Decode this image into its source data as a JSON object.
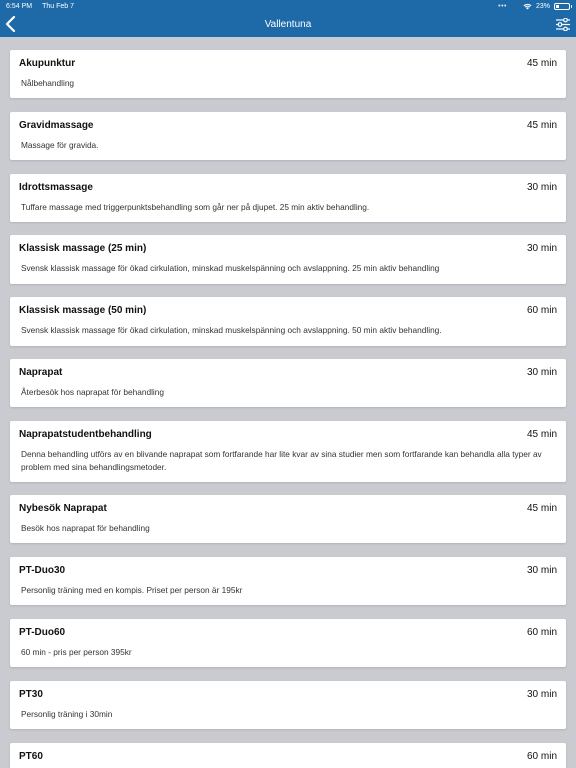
{
  "status": {
    "time": "6:54 PM",
    "date": "Thu Feb 7",
    "battery": "23%",
    "battery_level": 0.23,
    "dots": "•••"
  },
  "nav": {
    "title": "Vallentuna",
    "back_icon": "chevron-left-icon",
    "filter_icon": "sliders-icon"
  },
  "colors": {
    "accent": "#1e6aa8",
    "background": "#c9cbd0",
    "card": "#ffffff"
  },
  "services": [
    {
      "name": "Akupunktur",
      "duration": "45 min",
      "description": "Nålbehandling"
    },
    {
      "name": "Gravidmassage",
      "duration": "45 min",
      "description": "Massage för gravida."
    },
    {
      "name": "Idrottsmassage",
      "duration": "30 min",
      "description": "Tuffare massage med triggerpunktsbehandling som går ner på djupet. 25 min aktiv behandling."
    },
    {
      "name": "Klassisk massage (25 min)",
      "duration": "30 min",
      "description": "Svensk klassisk massage för ökad cirkulation, minskad muskelspänning och avslappning. 25 min aktiv behandling"
    },
    {
      "name": "Klassisk massage (50 min)",
      "duration": "60 min",
      "description": "Svensk klassisk massage för ökad cirkulation, minskad muskelspänning och avslappning. 50 min aktiv behandling."
    },
    {
      "name": "Naprapat",
      "duration": "30 min",
      "description": "Återbesök hos naprapat för behandling"
    },
    {
      "name": "Naprapatstudentbehandling",
      "duration": "45 min",
      "description": "Denna behandling utförs av en blivande naprapat som fortfarande har lite kvar av sina studier men som fortfarande kan behandla alla typer av problem med sina behandlingsmetoder."
    },
    {
      "name": "Nybesök Naprapat",
      "duration": "45 min",
      "description": "Besök hos naprapat för behandling"
    },
    {
      "name": "PT-Duo30",
      "duration": "30 min",
      "description": "Personlig träning med en kompis. Priset per person är 195kr"
    },
    {
      "name": "PT-Duo60",
      "duration": "60 min",
      "description": "60 min - pris per person 395kr"
    },
    {
      "name": "PT30",
      "duration": "30 min",
      "description": "Personlig träning i 30min"
    },
    {
      "name": "PT60",
      "duration": "60 min",
      "description": ""
    }
  ]
}
